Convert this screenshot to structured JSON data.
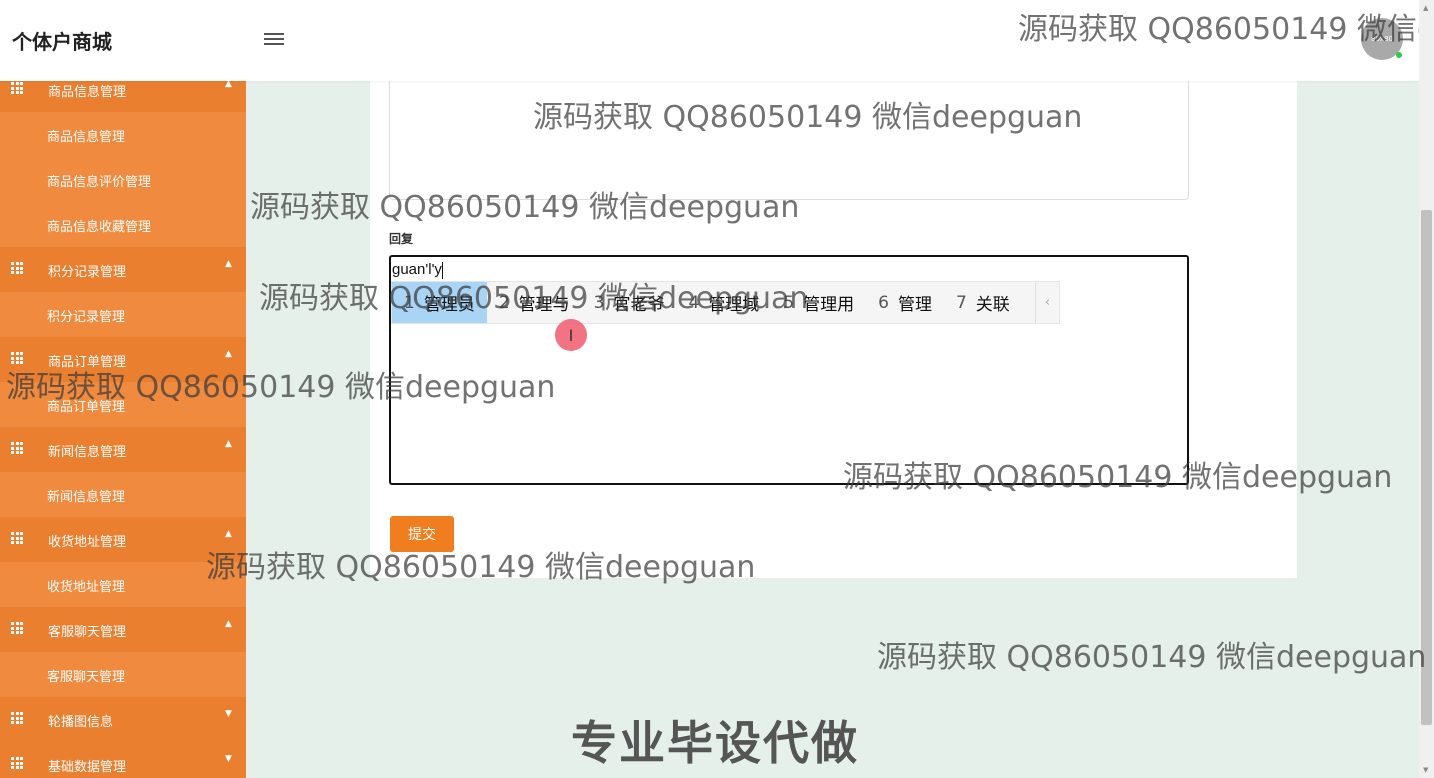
{
  "header": {
    "brand": "个体户商城",
    "menu_icon": "hamburger-icon",
    "avatar_text": "80x80"
  },
  "sidebar": {
    "groups": [
      {
        "label": "商品信息管理",
        "icon": "grid-icon",
        "expanded": true
      },
      {
        "label": "积分记录管理",
        "icon": "grid-icon",
        "expanded": true
      },
      {
        "label": "商品订单管理",
        "icon": "grid-icon",
        "expanded": true
      },
      {
        "label": "新闻信息管理",
        "icon": "grid-icon",
        "expanded": true
      },
      {
        "label": "收货地址管理",
        "icon": "grid-icon",
        "expanded": true
      },
      {
        "label": "客服聊天管理",
        "icon": "grid-icon",
        "expanded": true
      },
      {
        "label": "轮播图信息",
        "icon": "grid-icon",
        "expanded": false
      },
      {
        "label": "基础数据管理",
        "icon": "grid-icon",
        "expanded": false
      }
    ],
    "items": [
      {
        "label": "商品信息管理"
      },
      {
        "label": "商品信息评价管理"
      },
      {
        "label": "商品信息收藏管理"
      },
      {
        "label": "积分记录管理"
      },
      {
        "label": "商品订单管理"
      },
      {
        "label": "新闻信息管理"
      },
      {
        "label": "收货地址管理"
      },
      {
        "label": "客服聊天管理"
      }
    ]
  },
  "form": {
    "reply_label": "回复",
    "reply_value": "guan'l'y",
    "submit_label": "提交"
  },
  "ime": {
    "candidates": [
      {
        "num": "1",
        "text": "管理员"
      },
      {
        "num": "2",
        "text": "管理与"
      },
      {
        "num": "3",
        "text": "官老爷"
      },
      {
        "num": "4",
        "text": "管理域"
      },
      {
        "num": "5",
        "text": "管理用"
      },
      {
        "num": "6",
        "text": "管理"
      },
      {
        "num": "7",
        "text": "关联"
      }
    ],
    "prev_arrow": "‹"
  },
  "watermarks": {
    "source": "源码获取 QQ86050149 微信deepguan",
    "source_clipped": "源码获取 QQ86050149 微信de",
    "promo": "专业毕设代做"
  },
  "colors": {
    "sidebar": "#f08a3e",
    "accent": "#f07d1e",
    "ime_highlight": "#a8d4f5"
  }
}
